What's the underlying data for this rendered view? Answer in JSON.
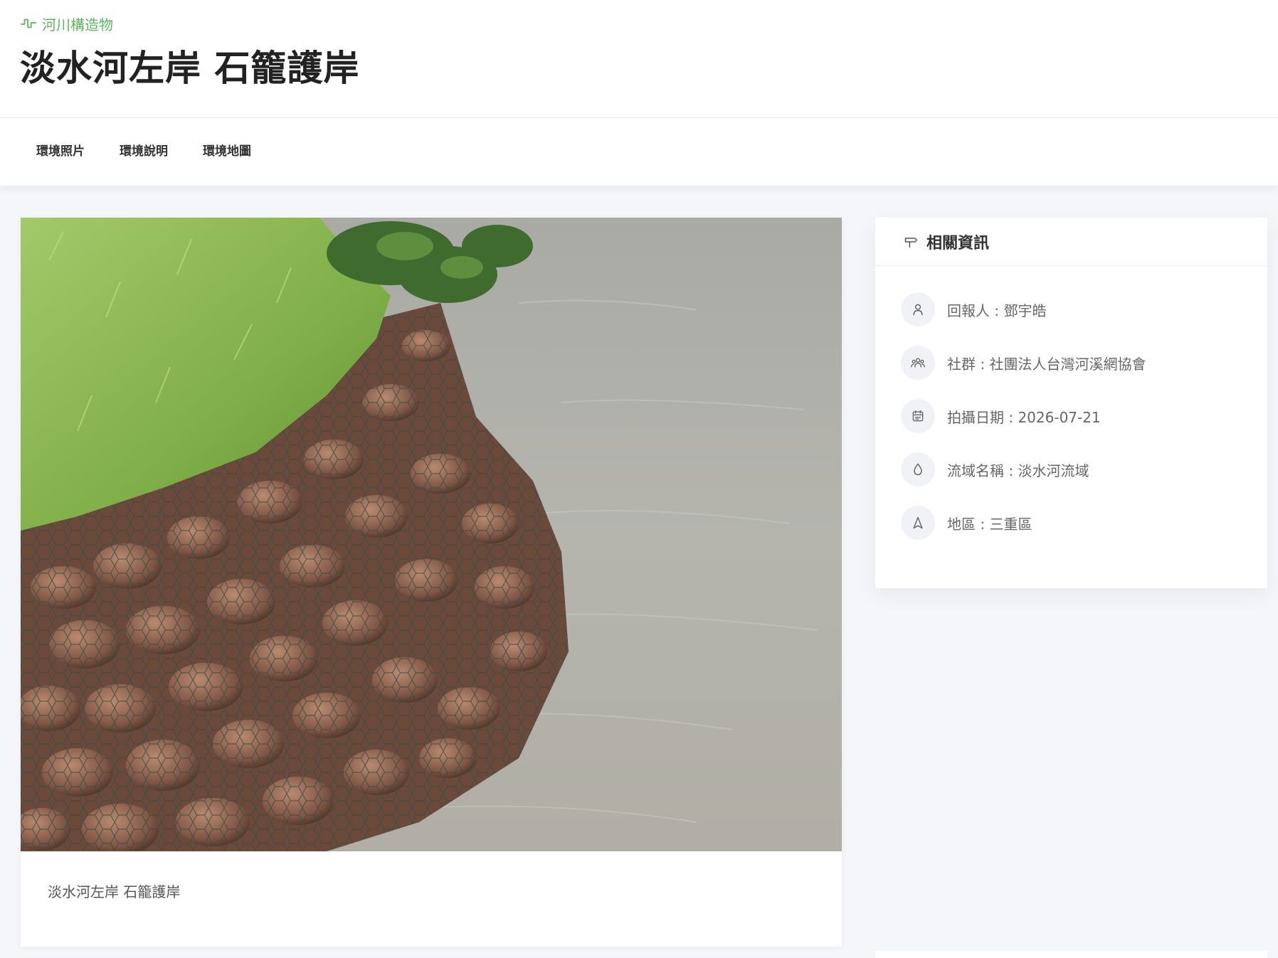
{
  "header": {
    "category": "河川構造物",
    "title": "淡水河左岸 石籠護岸"
  },
  "tabs": [
    {
      "label": "環境照片"
    },
    {
      "label": "環境說明"
    },
    {
      "label": "環境地圖"
    }
  ],
  "photo": {
    "caption": "淡水河左岸 石籠護岸"
  },
  "info": {
    "title": "相關資訊",
    "items": [
      {
        "icon": "user-icon",
        "text": "回報人 : 鄧宇皓"
      },
      {
        "icon": "group-icon",
        "text": "社群 : 社團法人台灣河溪網協會"
      },
      {
        "icon": "calendar-icon",
        "text": "拍攝日期 : 2026-07-21"
      },
      {
        "icon": "water-drop-icon",
        "text": "流域名稱 : 淡水河流域"
      },
      {
        "icon": "navigation-icon",
        "text": "地區 : 三重區"
      }
    ]
  },
  "colors": {
    "accent": "#5cb85c",
    "background": "#f5f6f9"
  }
}
